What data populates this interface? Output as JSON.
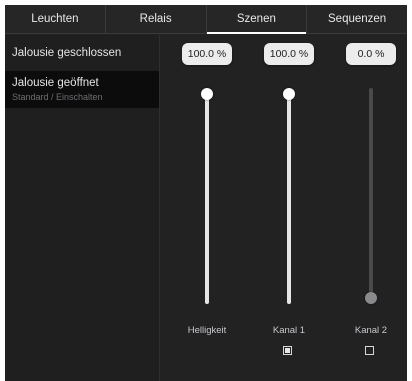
{
  "tabs": [
    {
      "label": "Leuchten",
      "active": false
    },
    {
      "label": "Relais",
      "active": false
    },
    {
      "label": "Szenen",
      "active": true
    },
    {
      "label": "Sequenzen",
      "active": false
    }
  ],
  "scenes": [
    {
      "title": "Jalousie geschlossen",
      "subtitle": "",
      "selected": false
    },
    {
      "title": "Jalousie geöffnet",
      "subtitle": "Standard / Einschalten",
      "selected": true
    }
  ],
  "channels": [
    {
      "label": "Helligkeit",
      "value_text": "100.0 %",
      "level": 1.0,
      "has_checkbox": false,
      "checked": false
    },
    {
      "label": "Kanal 1",
      "value_text": "100.0 %",
      "level": 1.0,
      "has_checkbox": true,
      "checked": true
    },
    {
      "label": "Kanal 2",
      "value_text": "0.0 %",
      "level": 0.0,
      "has_checkbox": true,
      "checked": false
    }
  ]
}
